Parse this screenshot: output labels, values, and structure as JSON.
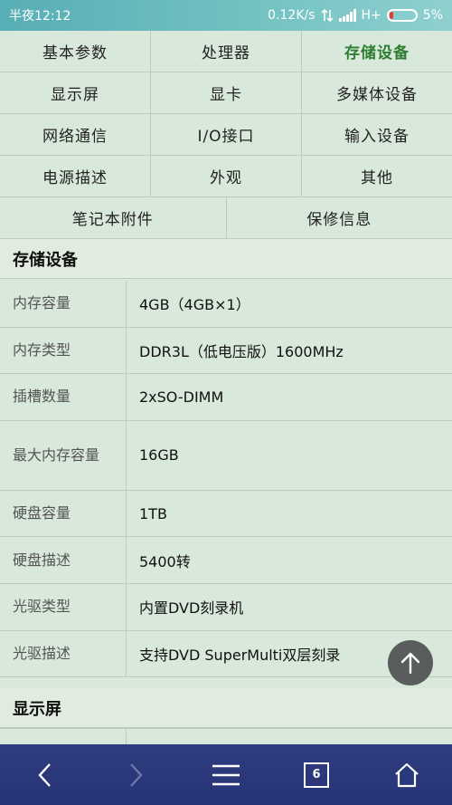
{
  "status": {
    "time": "半夜12:12",
    "speed": "0.12K/s",
    "network": "H+",
    "battery": "5%"
  },
  "categories": [
    [
      "基本参数",
      "处理器",
      "存储设备"
    ],
    [
      "显示屏",
      "显卡",
      "多媒体设备"
    ],
    [
      "网络通信",
      "I/O接口",
      "输入设备"
    ],
    [
      "电源描述",
      "外观",
      "其他"
    ],
    [
      "笔记本附件",
      "保修信息"
    ]
  ],
  "active_category": "存储设备",
  "section": {
    "title": "存储设备",
    "rows": [
      {
        "key": "内存容量",
        "value": "4GB（4GB×1）"
      },
      {
        "key": "内存类型",
        "value": "DDR3L（低电压版）1600MHz"
      },
      {
        "key": "插槽数量",
        "value": "2xSO-DIMM"
      },
      {
        "key": "最大内存容量",
        "value": "16GB"
      },
      {
        "key": "硬盘容量",
        "value": "1TB"
      },
      {
        "key": "硬盘描述",
        "value": "5400转"
      },
      {
        "key": "光驱类型",
        "value": "内置DVD刻录机"
      },
      {
        "key": "光驱描述",
        "value": "支持DVD SuperMulti双层刻录"
      }
    ]
  },
  "next_section": {
    "title": "显示屏"
  },
  "bottom_nav": {
    "tab_count": "6"
  },
  "colors": {
    "active": "#2e7d32",
    "bottom_bar": "#2f3d80"
  }
}
